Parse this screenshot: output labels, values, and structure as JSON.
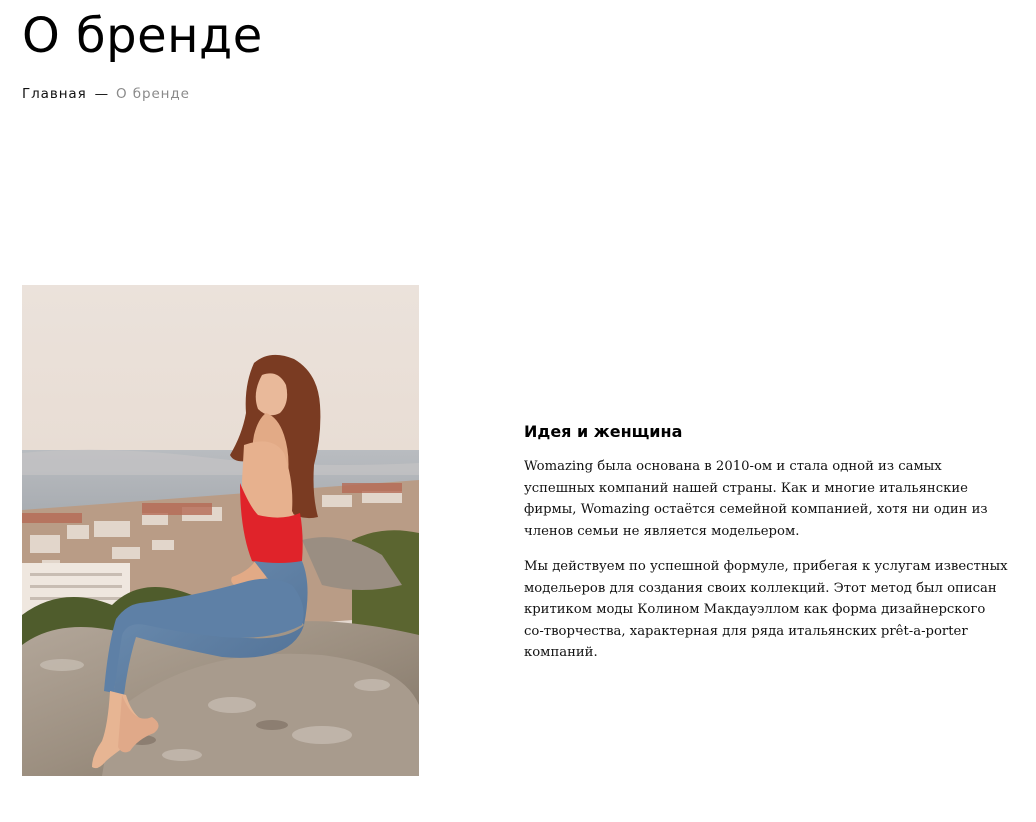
{
  "page": {
    "title": "О бренде"
  },
  "breadcrumb": {
    "home": "Главная",
    "separator": "—",
    "current": "О бренде"
  },
  "photo": {
    "icon": "photo-woman-sitting-on-rock"
  },
  "about": {
    "title": "Идея и женщина",
    "paragraphs": [
      "Womazing была основана в 2010-ом и стала одной из самых успешных компаний нашей страны. Как и многие итальянские фирмы, Womazing остаётся семейной компанией, хотя ни один из членов семьи не является модельером.",
      "Мы действуем по успешной формуле, прибегая к услугам известных модельеров для создания своих коллекций. Этот метод был описан критиком моды Колином Макдауэллом как форма дизайнерского со-творчества, характерная для ряда итальянских prêt-a-porter компаний."
    ]
  },
  "colors": {
    "text": "#000000",
    "breadcrumb_current": "#8a8a8a",
    "background": "#ffffff"
  }
}
